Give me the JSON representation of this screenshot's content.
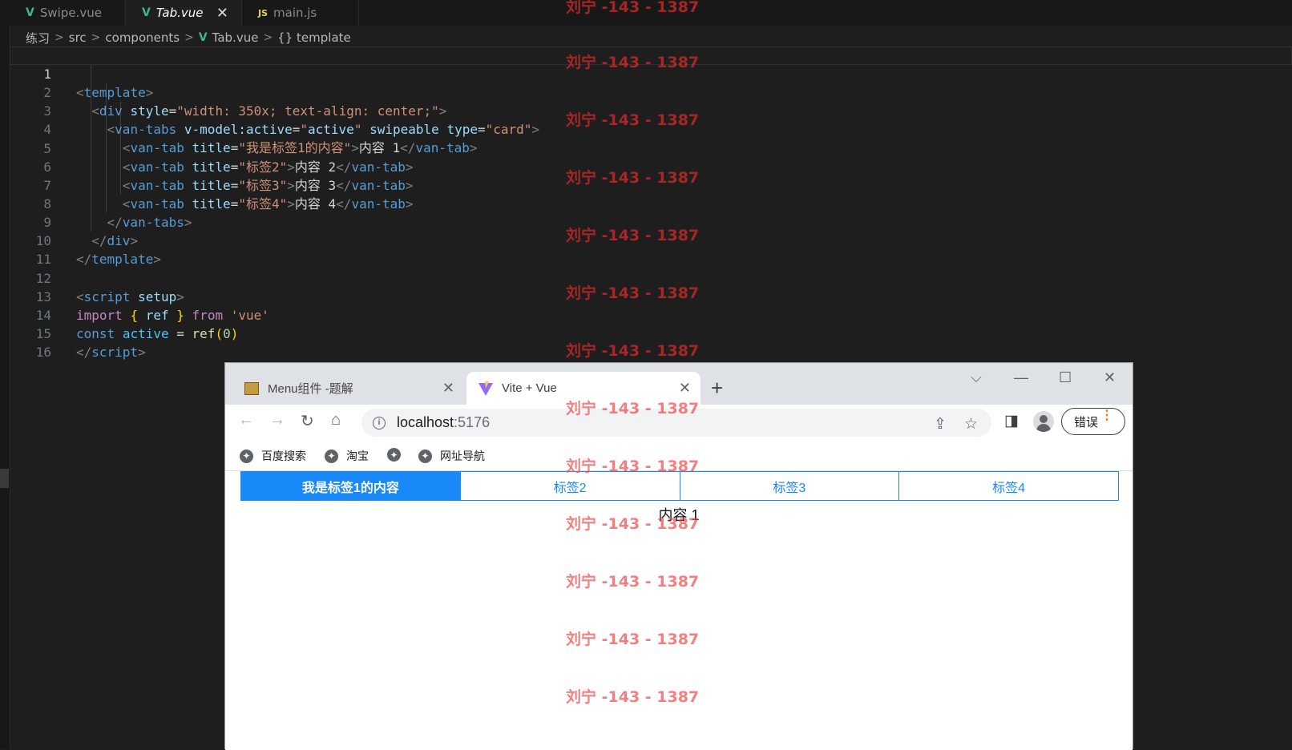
{
  "editor": {
    "tabs": [
      {
        "icon": "vue-file-icon",
        "label": "Swipe.vue"
      },
      {
        "icon": "vue-file-icon",
        "label": "Tab.vue",
        "close": "✕"
      },
      {
        "icon": "js-file-icon",
        "icon_text": "JS",
        "label": "main.js"
      }
    ],
    "breadcrumbs": [
      "练习",
      "src",
      "components",
      "Tab.vue",
      "{} template"
    ],
    "breadcrumb_separator": ">",
    "line_numbers": [
      "1",
      "2",
      "3",
      "4",
      "5",
      "6",
      "7",
      "8",
      "9",
      "10",
      "11",
      "12",
      "13",
      "14",
      "15",
      "16"
    ],
    "code": {
      "l1": {
        "tag": "template"
      },
      "l2": {
        "tag": "div",
        "attr": "style",
        "val": "width: 350x; text-align: center;"
      },
      "l3": {
        "tag": "van-tabs",
        "attr1": "v-model:active",
        "val1": "active",
        "attr2": "swipeable",
        "attr3": "type",
        "val3": "card"
      },
      "l4": {
        "tag": "van-tab",
        "attr": "title",
        "val": "我是标签1的内容",
        "text": "内容 1"
      },
      "l5": {
        "tag": "van-tab",
        "attr": "title",
        "val": "标签2",
        "text": "内容 2"
      },
      "l6": {
        "tag": "van-tab",
        "attr": "title",
        "val": "标签3",
        "text": "内容 3"
      },
      "l7": {
        "tag": "van-tab",
        "attr": "title",
        "val": "标签4",
        "text": "内容 4"
      },
      "l8": {
        "tag": "van-tabs"
      },
      "l9": {
        "tag": "div"
      },
      "l10": {
        "tag": "template"
      },
      "l12": {
        "tag": "script",
        "attr": "setup"
      },
      "l13": {
        "kw": "import",
        "name": "ref",
        "from": "from",
        "module": "'vue'"
      },
      "l14": {
        "kw": "const",
        "name": "active",
        "op": "=",
        "fn": "ref",
        "num": "0"
      },
      "l15": {
        "tag": "script"
      }
    }
  },
  "watermark": "刘宁 -143 - 1387",
  "browser": {
    "tabs": [
      {
        "title": "Menu组件 -题解",
        "close": "✕"
      },
      {
        "title": "Vite + Vue",
        "close": "✕"
      }
    ],
    "new_tab": "+",
    "window_controls": {
      "tab_search": "⌵",
      "minimize": "—",
      "maximize": "☐",
      "close": "✕"
    },
    "nav": {
      "back": "←",
      "forward": "→",
      "reload": "↻",
      "home": "⌂"
    },
    "url": {
      "host": "localhost",
      "port": ":5176"
    },
    "omnibox_icons": {
      "share": "⇪",
      "star": "☆"
    },
    "side_panel_icon": "◨",
    "error_button": "错误",
    "error_menu": "⋮",
    "bookmarks": [
      "百度搜索",
      "淘宝",
      "",
      "网址导航"
    ],
    "page": {
      "tabs": [
        "我是标签1的内容",
        "标签2",
        "标签3",
        "标签4"
      ],
      "active_tab": 0,
      "content": "内容 1"
    }
  },
  "colors": {
    "editor_bg": "#1e1e1e",
    "vant_blue": "#1989fa",
    "watermark": "#ce2a2a"
  }
}
